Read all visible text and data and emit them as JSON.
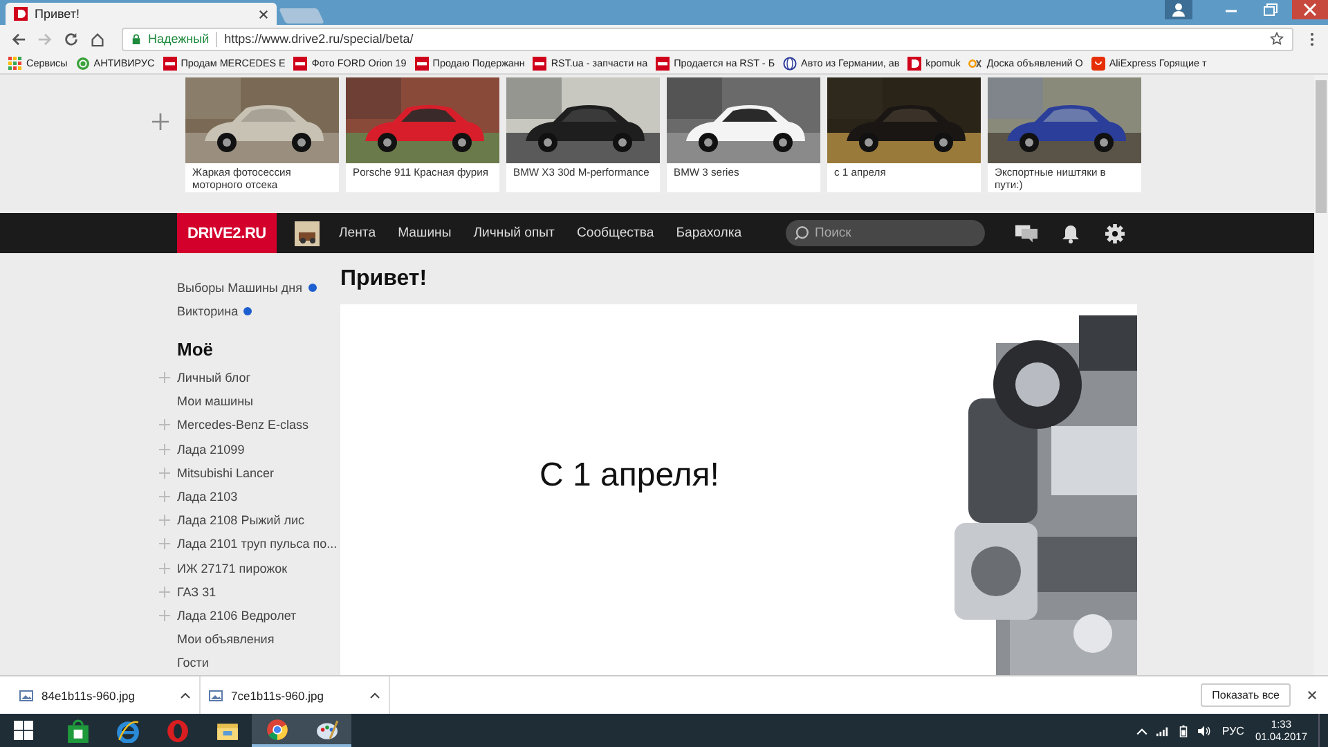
{
  "browser": {
    "tabs": [
      {
        "title": "Привет!",
        "selected": true
      }
    ],
    "security_label": "Надежный",
    "url": "https://www.drive2.ru/special/beta/",
    "bookmarks": [
      {
        "label": "Сервисы",
        "kind": "apps"
      },
      {
        "label": "АНТИВИРУС",
        "kind": "shield"
      },
      {
        "label": "Продам MERCEDES E",
        "kind": "rst"
      },
      {
        "label": "Фото FORD Orion 19",
        "kind": "rst"
      },
      {
        "label": "Продаю Подержанн",
        "kind": "rst"
      },
      {
        "label": "RST.ua - запчасти на",
        "kind": "rst"
      },
      {
        "label": "Продается на RST - Б",
        "kind": "rst"
      },
      {
        "label": "Авто из Германии, ав",
        "kind": "globe"
      },
      {
        "label": "kpomuk",
        "kind": "drive"
      },
      {
        "label": "Доска объявлений О",
        "kind": "ok"
      },
      {
        "label": "AliExpress Горящие т",
        "kind": "ali"
      }
    ]
  },
  "gallery": [
    {
      "caption": "Жаркая фотосессия моторного отсека"
    },
    {
      "caption": "Porsche 911 Красная фурия"
    },
    {
      "caption": "BMW X3 30d M-performance"
    },
    {
      "caption": "BMW 3 series"
    },
    {
      "caption": "с 1 апреля"
    },
    {
      "caption": "Экспортные ништяки в пути:)"
    }
  ],
  "nav": {
    "logo": "DRIVE2.RU",
    "items": [
      "Лента",
      "Машины",
      "Личный опыт",
      "Сообщества",
      "Барахолка"
    ],
    "search_placeholder": "Поиск"
  },
  "sidebar": {
    "links": [
      {
        "label": "Выборы Машины дня",
        "unread": true
      },
      {
        "label": "Викторина",
        "unread": true
      }
    ],
    "section_title": "Моё",
    "items": [
      {
        "label": "Личный блог",
        "expandable": true
      },
      {
        "label": "Мои машины",
        "expandable": false
      },
      {
        "label": "Mercedes-Benz E-class",
        "expandable": true
      },
      {
        "label": "Лада 21099",
        "expandable": true
      },
      {
        "label": "Mitsubishi Lancer",
        "expandable": true
      },
      {
        "label": "Лада 2103",
        "expandable": true
      },
      {
        "label": "Лада 2108 Рыжий лис",
        "expandable": true
      },
      {
        "label": "Лада 2101 труп пульса по...",
        "expandable": true
      },
      {
        "label": "ИЖ 27171 пирожок",
        "expandable": true
      },
      {
        "label": "ГАЗ 31",
        "expandable": true
      },
      {
        "label": "Лада 2106 Ведролет",
        "expandable": true
      },
      {
        "label": "Мои объявления",
        "expandable": false
      },
      {
        "label": "Гости",
        "expandable": false
      }
    ]
  },
  "main": {
    "title": "Привет!",
    "banner_text": "С 1 апреля!"
  },
  "downloads": {
    "files": [
      "84e1b11s-960.jpg",
      "7ce1b11s-960.jpg"
    ],
    "show_all": "Показать все"
  },
  "taskbar": {
    "apps": [
      {
        "kind": "store",
        "running": false
      },
      {
        "kind": "ie",
        "running": false
      },
      {
        "kind": "opera",
        "running": false
      },
      {
        "kind": "folder",
        "running": false
      },
      {
        "kind": "chrome",
        "running": true
      },
      {
        "kind": "paint",
        "running": true
      }
    ],
    "language": "РУС",
    "time": "1:33",
    "date": "01.04.2017"
  }
}
